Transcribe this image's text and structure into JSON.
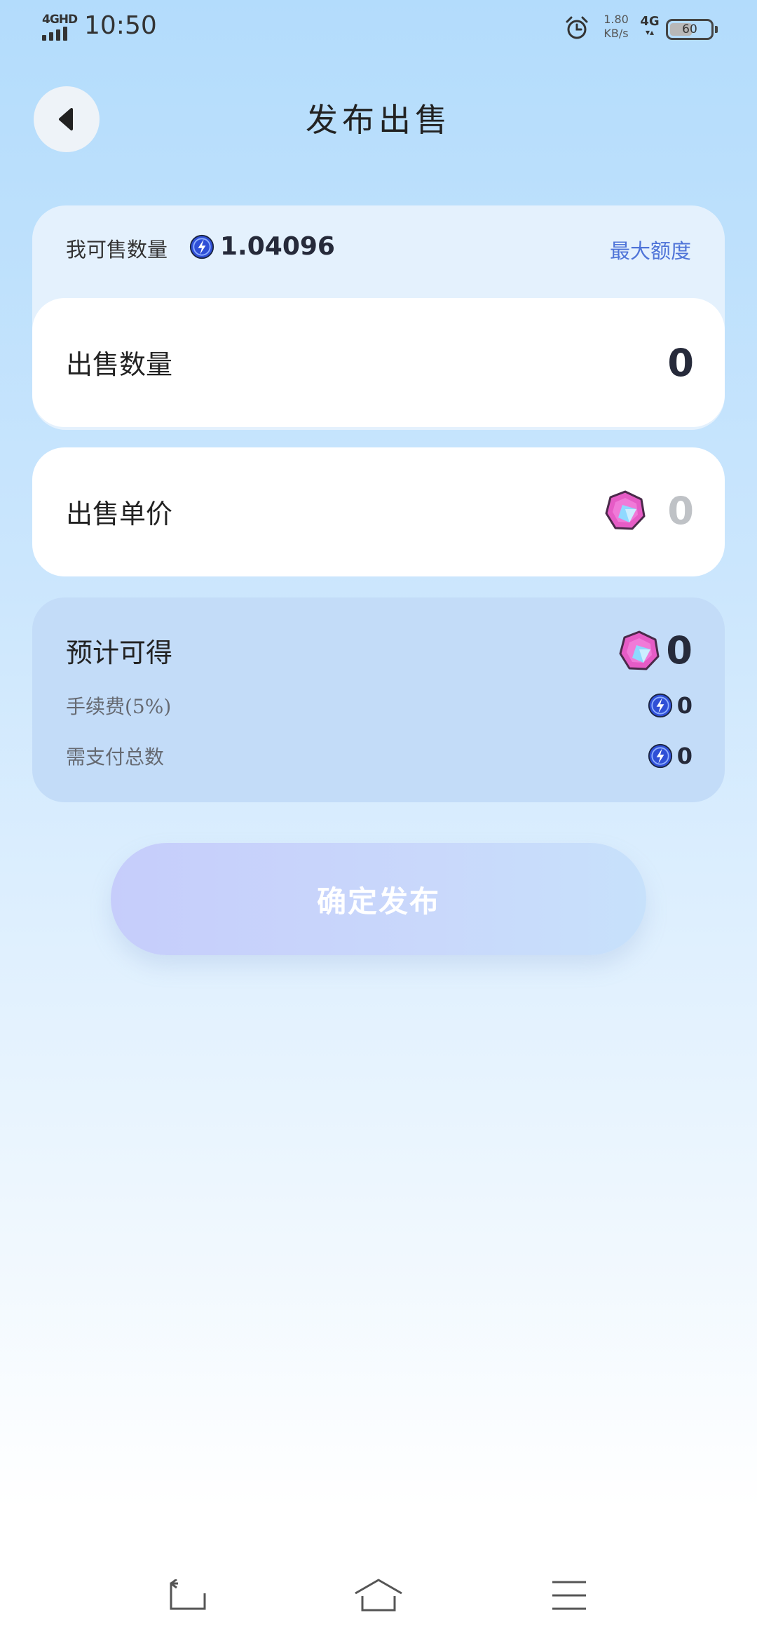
{
  "status_bar": {
    "network": "4GHD",
    "time": "10:50",
    "speed_value": "1.80",
    "speed_unit": "KB/s",
    "network_right": "4G",
    "battery": "60",
    "battery_level": 0.6
  },
  "header": {
    "title": "发布出售"
  },
  "available": {
    "label": "我可售数量",
    "amount": "1.04096",
    "max_label": "最大额度"
  },
  "quantity": {
    "label": "出售数量",
    "value": "",
    "placeholder": "0"
  },
  "unit_price": {
    "label": "出售单价",
    "value": "",
    "placeholder": "0"
  },
  "estimate": {
    "label": "预计可得",
    "value": "0",
    "fee_label": "手续费(5%)",
    "fee_value": "0",
    "total_label": "需支付总数",
    "total_value": "0"
  },
  "confirm": {
    "label": "确定发布"
  },
  "icons": {
    "coin": "blue-lightning-coin-icon",
    "gem": "pink-gem-icon"
  },
  "colors": {
    "accent": "#4f74d8",
    "text_dark": "#262a3a",
    "placeholder_gray": "#bfc2c6",
    "coin_blue": "#2f4fd6",
    "gem_pink": "#e65cc6"
  }
}
